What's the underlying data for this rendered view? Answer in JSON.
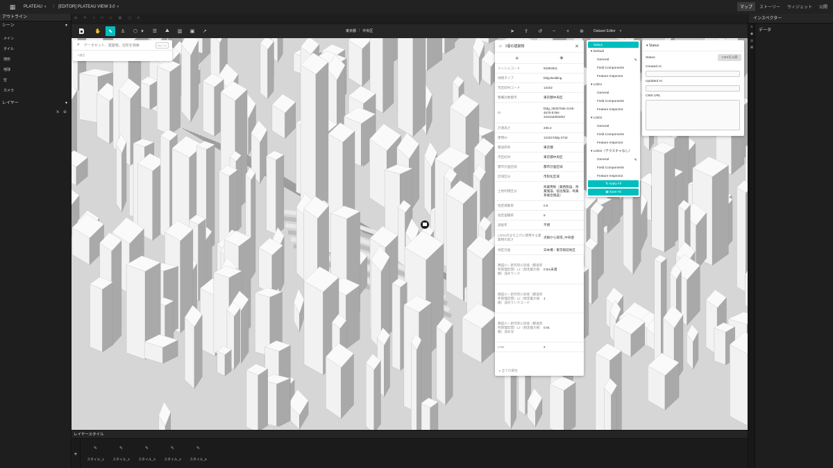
{
  "header": {
    "brand": "PLATEAU",
    "separator": "/",
    "project": "[EDITOR] PLATEAU VIEW 3.0",
    "tabs": [
      "マップ",
      "ストーリー",
      "ウィジェット",
      "公開"
    ],
    "active_tab": "マップ"
  },
  "left": {
    "outline_title": "アウトライン",
    "scene_label": "シーン",
    "scene_items": [
      "メイン",
      "タイル",
      "地形",
      "地球",
      "空",
      "カメラ"
    ],
    "layer_label": "レイヤー"
  },
  "toolbar": {
    "crumbs": [
      "東京都",
      "中央区"
    ],
    "editor_label": "Dataset Editor"
  },
  "right": {
    "inspector_title": "インスペクター",
    "data_tab": "データ"
  },
  "search": {
    "placeholder": "データセット、建築物、住所を検索",
    "shortcut": "Ctrl + K",
    "hint": "3項目"
  },
  "building": {
    "title": "1個の建築物",
    "rows": [
      {
        "k": "メッシュコード",
        "v": "53394611"
      },
      {
        "k": "地物タイプ",
        "v": "bldg:Building"
      },
      {
        "k": "市区町村コード",
        "v": "13102"
      },
      {
        "k": "整備対象都市",
        "v": "東京都中央区"
      },
      {
        "k": "ID",
        "v": "bldg_25d370de-2c35-457b-b756-3444a3d02eb3"
      },
      {
        "k": "計測高さ",
        "v": "235.2"
      },
      {
        "k": "建物ID",
        "v": "13102-bldg-3742"
      },
      {
        "k": "都道府県",
        "v": "東京都"
      },
      {
        "k": "市区町村",
        "v": "東京都中央区"
      },
      {
        "k": "都市計画区域",
        "v": "都市計画区域"
      },
      {
        "k": "区域区分",
        "v": "市街化区域"
      },
      {
        "k": "土地利用区分",
        "v": "商業用地（業務施設、商業施設、宿泊施設、商業系複合施設）"
      },
      {
        "k": "指定建蔽率",
        "v": "0.8"
      },
      {
        "k": "指定容積率",
        "v": "9"
      },
      {
        "k": "調査年",
        "v": "不明"
      },
      {
        "k": "LOD1の立ち上げに使用する建築物の高さ",
        "v": "点群から取得_中央値"
      },
      {
        "k": "地区計画",
        "v": "日本橋・東京駅前地区"
      },
      {
        "k": "隅田川・新河岸川流域（都道府県管理区間）L2（想定最大規模）浸水ランク",
        "v": "0.5m未満"
      },
      {
        "k": "隅田川・新河岸川流域（都道府県管理区間）L2（想定最大規模）浸水ランクコード",
        "v": "1"
      },
      {
        "k": "隅田川・新河岸川流域（都道府県管理区間）L2（想定最大規模）浸水深",
        "v": "0.01"
      },
      {
        "k": "LOD",
        "v": "2"
      }
    ],
    "footer": "全ての属性"
  },
  "tree": {
    "status_label": "Status",
    "groups": [
      {
        "name": "Default",
        "items": [
          "General",
          "Field Components",
          "Feature Inspector"
        ],
        "edited": "General"
      },
      {
        "name": "LOD1",
        "items": [
          "General",
          "Field Components",
          "Feature Inspector"
        ]
      },
      {
        "name": "LOD2",
        "items": [
          "General",
          "Field Components",
          "Feature Inspector"
        ]
      },
      {
        "name": "LOD2（テクスチャなし）",
        "items": [
          "General",
          "Field Components",
          "Feature Inspector"
        ],
        "edited": "General"
      }
    ],
    "apply_label": "Apply All",
    "save_label": "Save All"
  },
  "status_card": {
    "title": "Status",
    "status_label": "Status",
    "cms_button": "CMSを公開",
    "created_label": "Created At",
    "updated_label": "Updated At",
    "url_label": "CMS URL"
  },
  "bottom": {
    "title": "レイヤースタイル",
    "add_label": "+",
    "styles": [
      "スタイル_1",
      "スタイル_2",
      "スタイル_3",
      "スタイル_4",
      "スタイル_5"
    ]
  },
  "colors": {
    "accent": "#00bebe",
    "bg": "#1c1c1c"
  }
}
